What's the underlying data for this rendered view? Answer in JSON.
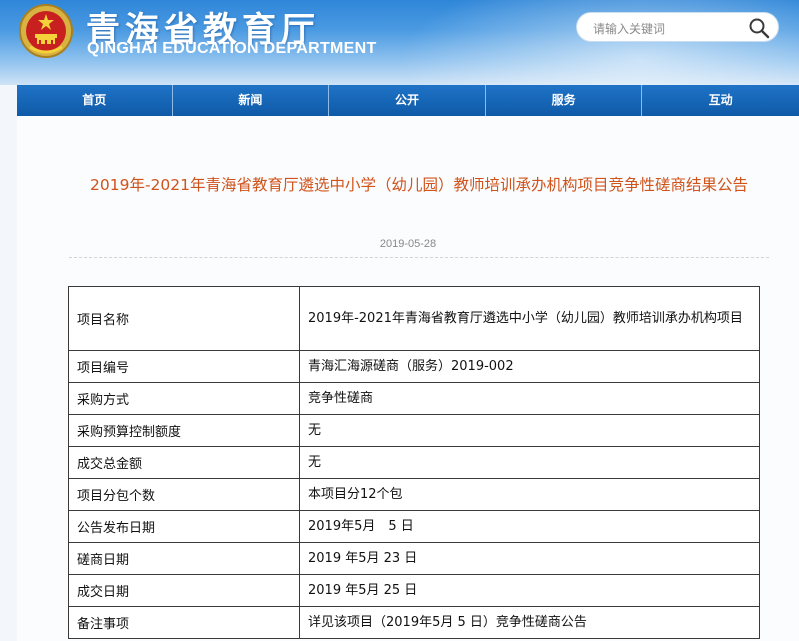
{
  "header": {
    "title": "青海省教育厅",
    "subtitle": "QINGHAI EDUCATION DEPARTMENT",
    "search_placeholder": "请输入关键词"
  },
  "nav": {
    "items": [
      {
        "label": "首页"
      },
      {
        "label": "新闻"
      },
      {
        "label": "公开"
      },
      {
        "label": "服务"
      },
      {
        "label": "互动"
      }
    ]
  },
  "article": {
    "title": "2019年-2021年青海省教育厅遴选中小学（幼儿园）教师培训承办机构项目竞争性磋商结果公告",
    "date": "2019-05-28"
  },
  "table": {
    "rows": [
      {
        "label": "项目名称",
        "value": "2019年-2021年青海省教育厅遴选中小学（幼儿园）教师培训承办机构项目"
      },
      {
        "label": "项目编号",
        "value": "青海汇海源磋商（服务）2019-002"
      },
      {
        "label": "采购方式",
        "value": "竞争性磋商"
      },
      {
        "label": "采购预算控制额度",
        "value": "无"
      },
      {
        "label": "成交总金额",
        "value": "无"
      },
      {
        "label": "项目分包个数",
        "value": "本项目分12个包"
      },
      {
        "label": "公告发布日期",
        "value": "2019年5月　5 日"
      },
      {
        "label": "磋商日期",
        "value": "2019 年5月 23 日"
      },
      {
        "label": "成交日期",
        "value": "2019 年5月 25 日"
      },
      {
        "label": "备注事项",
        "value": "详见该项目（2019年5月 5 日）竞争性磋商公告"
      }
    ]
  },
  "colors": {
    "nav_bg": "#1665b5",
    "title_color": "#d0531c",
    "header_sky": "#3c8fdc"
  }
}
